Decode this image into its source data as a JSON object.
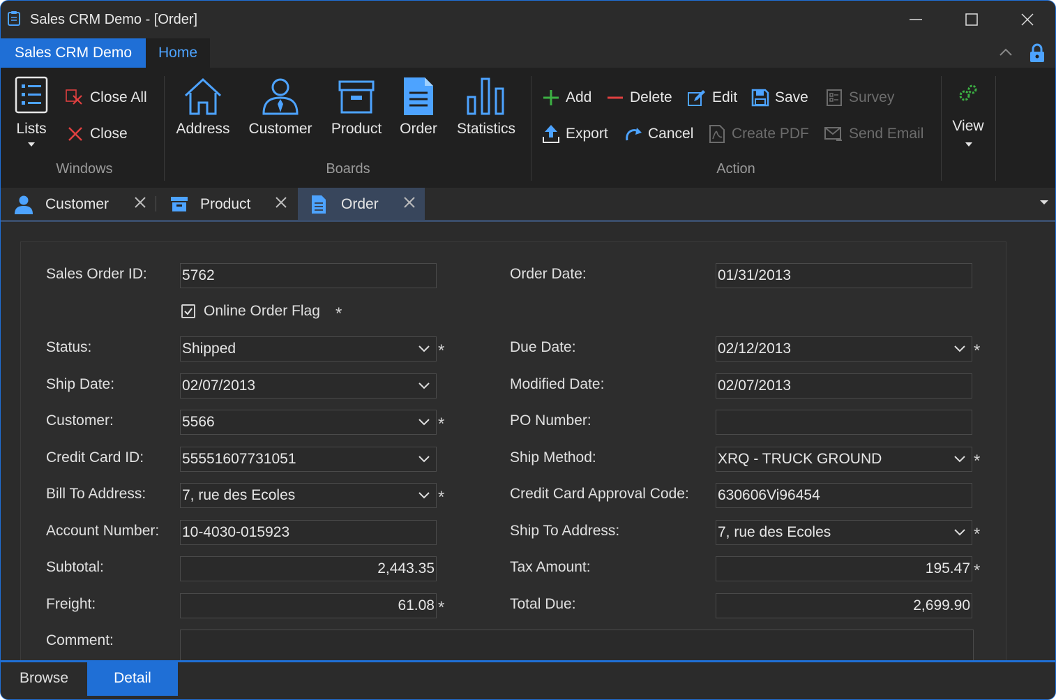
{
  "window": {
    "title": "Sales CRM Demo - [Order]"
  },
  "ribbon_tabs": {
    "app": "Sales CRM Demo",
    "home": "Home"
  },
  "groups": {
    "windows": {
      "label": "Windows",
      "lists": "Lists",
      "close_all": "Close All",
      "close": "Close"
    },
    "boards": {
      "label": "Boards",
      "address": "Address",
      "customer": "Customer",
      "product": "Product",
      "order": "Order",
      "statistics": "Statistics"
    },
    "action": {
      "label": "Action",
      "add": "Add",
      "delete": "Delete",
      "edit": "Edit",
      "save": "Save",
      "survey": "Survey",
      "export": "Export",
      "cancel": "Cancel",
      "create_pdf": "Create PDF",
      "send_email": "Send Email"
    },
    "view": {
      "label": "View"
    }
  },
  "doc_tabs": [
    {
      "label": "Customer"
    },
    {
      "label": "Product"
    },
    {
      "label": "Order"
    }
  ],
  "form": {
    "sales_order_id": {
      "label": "Sales Order ID:",
      "value": "5762"
    },
    "online_order_flag": {
      "label": "Online Order Flag",
      "checked": true
    },
    "status": {
      "label": "Status:",
      "value": "Shipped"
    },
    "ship_date": {
      "label": "Ship Date:",
      "value": "02/07/2013"
    },
    "customer": {
      "label": "Customer:",
      "value": "5566"
    },
    "credit_card_id": {
      "label": "Credit Card ID:",
      "value": "55551607731051"
    },
    "bill_to_address": {
      "label": "Bill To Address:",
      "value": "7, rue des Ecoles"
    },
    "account_number": {
      "label": "Account Number:",
      "value": "10-4030-015923"
    },
    "subtotal": {
      "label": "Subtotal:",
      "value": "2,443.35"
    },
    "freight": {
      "label": "Freight:",
      "value": "61.08"
    },
    "comment": {
      "label": "Comment:",
      "value": ""
    },
    "order_date": {
      "label": "Order Date:",
      "value": "01/31/2013"
    },
    "due_date": {
      "label": "Due Date:",
      "value": "02/12/2013"
    },
    "modified_date": {
      "label": "Modified Date:",
      "value": "02/07/2013"
    },
    "po_number": {
      "label": "PO Number:",
      "value": ""
    },
    "ship_method": {
      "label": "Ship Method:",
      "value": "XRQ - TRUCK GROUND"
    },
    "cc_approval_code": {
      "label": "Credit Card Approval Code:",
      "value": "630606Vi96454"
    },
    "ship_to_address": {
      "label": "Ship To Address:",
      "value": "7, rue des Ecoles"
    },
    "tax_amount": {
      "label": "Tax Amount:",
      "value": "195.47"
    },
    "total_due": {
      "label": "Total Due:",
      "value": "2,699.90"
    },
    "required_marker": "*"
  },
  "bottom_tabs": {
    "browse": "Browse",
    "detail": "Detail"
  },
  "colors": {
    "accent": "#1f6fd6",
    "background": "#2b2b2b",
    "ribbon": "#202020",
    "add_green": "#3cb043",
    "delete_red": "#e04040"
  },
  "icons": [
    "clipboard-icon",
    "minimize-icon",
    "maximize-icon",
    "close-icon",
    "chevron-up-icon",
    "lock-icon",
    "lists-icon",
    "close-all-icon",
    "close-x-icon",
    "house-icon",
    "person-icon",
    "box-icon",
    "document-icon",
    "bar-chart-icon",
    "plus-icon",
    "minus-icon",
    "edit-icon",
    "save-icon",
    "survey-icon",
    "export-icon",
    "undo-icon",
    "pdf-icon",
    "email-icon",
    "gears-icon",
    "chevron-down-icon"
  ]
}
